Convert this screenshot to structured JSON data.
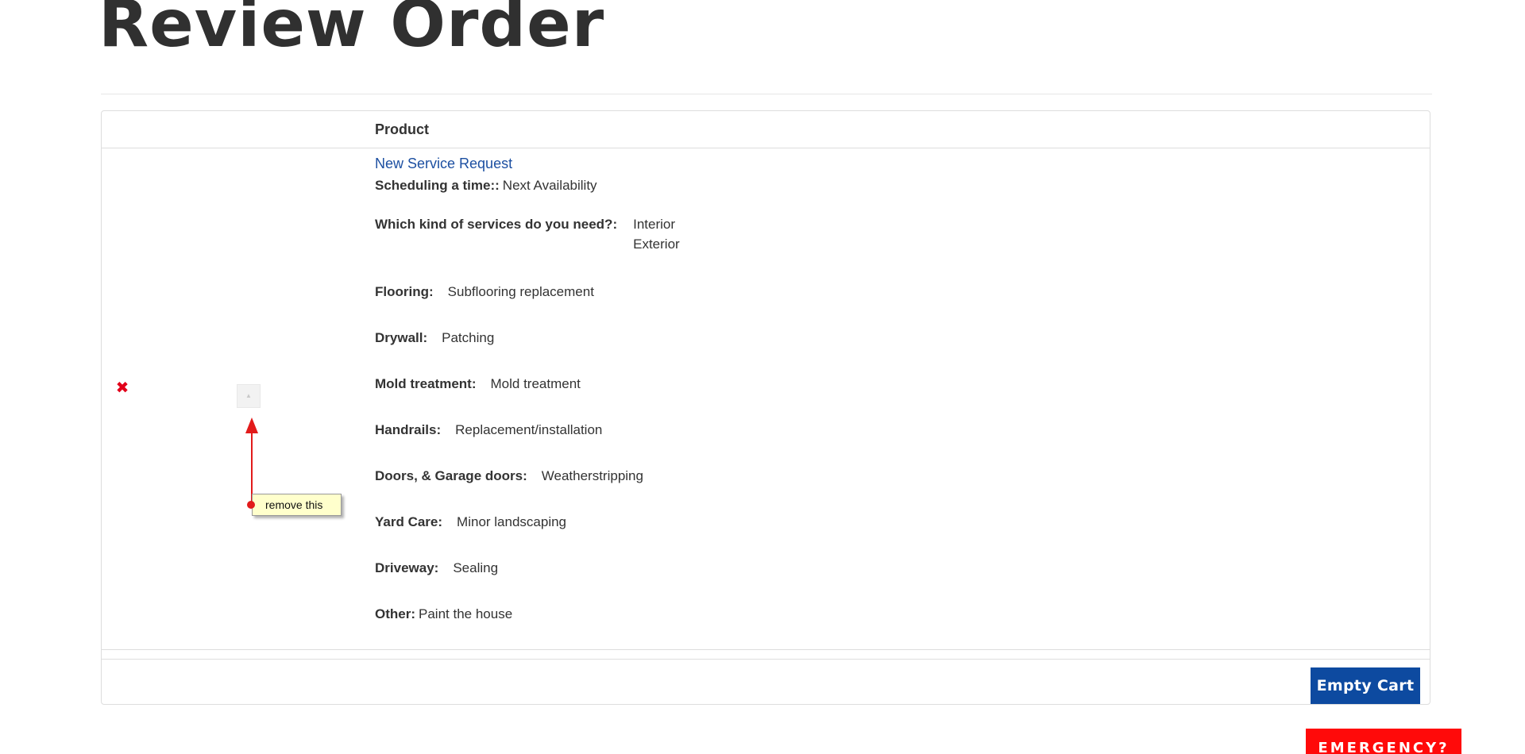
{
  "page": {
    "title": "Review Order"
  },
  "cart": {
    "columns": {
      "product": "Product"
    },
    "item": {
      "remove_glyph": "✖",
      "thumb_glyph": "▲",
      "product_name": "New Service Request",
      "options": [
        {
          "label": "Scheduling a time::",
          "value": "Next Availability"
        },
        {
          "label": "Which kind of services do you need?:",
          "values": [
            "Interior",
            "Exterior"
          ]
        },
        {
          "label": "Flooring:",
          "value": "Subflooring replacement"
        },
        {
          "label": "Drywall:",
          "value": "Patching"
        },
        {
          "label": "Mold treatment:",
          "value": "Mold treatment"
        },
        {
          "label": "Handrails:",
          "value": "Replacement/installation"
        },
        {
          "label": "Doors, & Garage doors:",
          "value": "Weatherstripping"
        },
        {
          "label": "Yard Care:",
          "value": "Minor landscaping"
        },
        {
          "label": "Driveway:",
          "value": "Sealing"
        },
        {
          "label": "Other:",
          "value": "Paint the house"
        }
      ]
    },
    "empty_cart_label": "Empty Cart"
  },
  "emergency_label": "EMERGENCY?",
  "annotation": {
    "note_text": "remove this"
  },
  "colors": {
    "link": "#1c4fa1",
    "primary_button": "#0d4aa0",
    "emergency": "#ff0a0a",
    "remove_icon": "#e2001a",
    "annotation": "#e21b1b",
    "note_background": "#ffffcc"
  }
}
